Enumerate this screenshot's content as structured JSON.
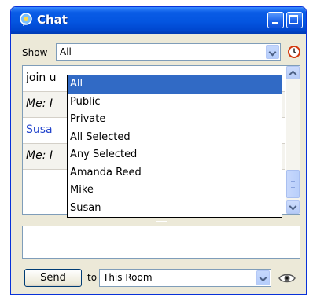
{
  "window": {
    "title": "Chat"
  },
  "show": {
    "label": "Show",
    "selected": "All",
    "options": [
      "All",
      "Public",
      "Private",
      "All Selected",
      "Any Selected",
      "Amanda Reed",
      "Mike",
      "Susan"
    ]
  },
  "messages": [
    {
      "text": "join u"
    },
    {
      "who": "Me: I"
    },
    {
      "who": "Susa"
    },
    {
      "who": "Me: I"
    }
  ],
  "compose": {
    "send_label": "Send",
    "to_label": "to",
    "recipient": "This Room"
  },
  "icons": {
    "app": "chat-bubble-icon",
    "history": "clock-icon",
    "watch": "eye-icon"
  },
  "colors": {
    "titlebar": "#0a5ce6",
    "selection": "#316ac5",
    "window_bg": "#ece9d8",
    "link": "#2244cc"
  }
}
